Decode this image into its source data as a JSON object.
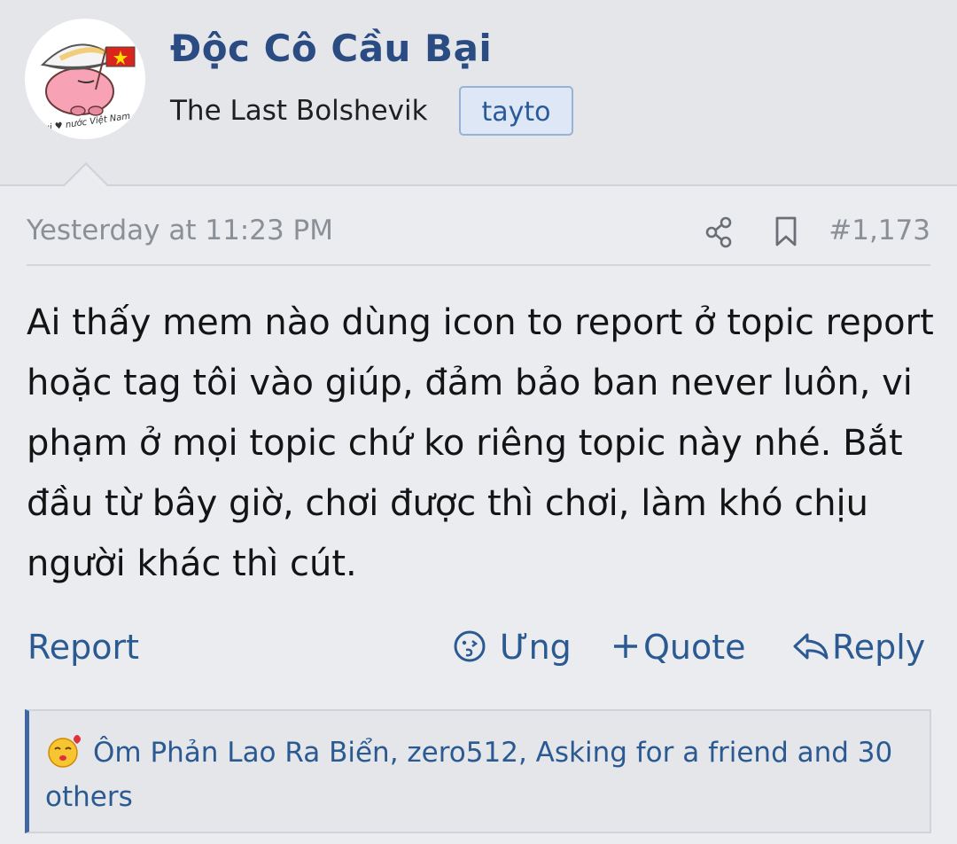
{
  "author": {
    "name": "Độc Cô Cầu Bại",
    "title": "The Last Bolshevik",
    "badge": "tayto",
    "avatar_caption": "Tui ♥ nước Việt Nam"
  },
  "post": {
    "timestamp": "Yesterday at 11:23 PM",
    "number": "#1,173",
    "message": "Ai thấy mem nào dùng icon to report ở topic report hoặc tag tôi vào giúp, đảm bảo ban never luôn, vi phạm ở mọi topic chứ ko riêng topic này nhé. Bắt đầu từ bây giờ, chơi được thì chơi, làm khó chịu người khác thì cút."
  },
  "actions": {
    "report": "Report",
    "react": "Ưng",
    "quote": "Quote",
    "reply": "Reply"
  },
  "reactions": {
    "summary": "Ôm Phản Lao Ra Biển, zero512, Asking for a friend and 30 others"
  },
  "icons": [
    "share-icon",
    "bookmark-icon",
    "react-icon",
    "plus-icon",
    "reply-arrow-icon",
    "kiss-emoji-icon"
  ],
  "colors": {
    "accent": "#2a4c83",
    "link": "#2b5a92",
    "muted": "#8b8f96",
    "badge_bg": "#dde7f6"
  }
}
